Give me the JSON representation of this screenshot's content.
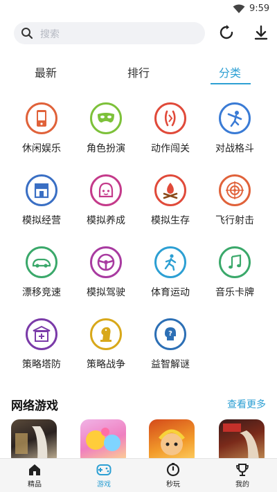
{
  "status_bar": {
    "time": "9:59"
  },
  "search": {
    "placeholder": "搜索"
  },
  "tabs": [
    {
      "label": "最新",
      "active": false
    },
    {
      "label": "排行",
      "active": false
    },
    {
      "label": "分类",
      "active": true
    }
  ],
  "categories": [
    {
      "label": "休闲娱乐",
      "icon": "phone-icon",
      "color": "#e0623a"
    },
    {
      "label": "角色扮演",
      "icon": "mask-icon",
      "color": "#7dc13a"
    },
    {
      "label": "动作闯关",
      "icon": "fighter-icon",
      "color": "#e04a3a"
    },
    {
      "label": "对战格斗",
      "icon": "kick-icon",
      "color": "#3a7bd5"
    },
    {
      "label": "模拟经营",
      "icon": "store-icon",
      "color": "#3a6fc4"
    },
    {
      "label": "模拟养成",
      "icon": "girl-icon",
      "color": "#c43a8a"
    },
    {
      "label": "模拟生存",
      "icon": "campfire-icon",
      "color": "#e04a3a"
    },
    {
      "label": "飞行射击",
      "icon": "target-icon",
      "color": "#e0623a"
    },
    {
      "label": "漂移竞速",
      "icon": "car-icon",
      "color": "#3aa86a"
    },
    {
      "label": "模拟驾驶",
      "icon": "steering-wheel-icon",
      "color": "#a83aa0"
    },
    {
      "label": "体育运动",
      "icon": "runner-icon",
      "color": "#2c9fd3"
    },
    {
      "label": "音乐卡牌",
      "icon": "music-note-icon",
      "color": "#3aa86a"
    },
    {
      "label": "策略塔防",
      "icon": "tower-icon",
      "color": "#7a3aa8"
    },
    {
      "label": "策略战争",
      "icon": "chess-knight-icon",
      "color": "#d8a81a"
    },
    {
      "label": "益智解谜",
      "icon": "puzzle-head-icon",
      "color": "#2c6fb5"
    }
  ],
  "section": {
    "title": "网络游戏",
    "more_label": "查看更多"
  },
  "bottom_nav": [
    {
      "label": "精品",
      "icon": "home-icon",
      "active": false
    },
    {
      "label": "游戏",
      "icon": "gamepad-icon",
      "active": true
    },
    {
      "label": "秒玩",
      "icon": "stopwatch-icon",
      "active": false
    },
    {
      "label": "我的",
      "icon": "trophy-icon",
      "active": false
    }
  ]
}
